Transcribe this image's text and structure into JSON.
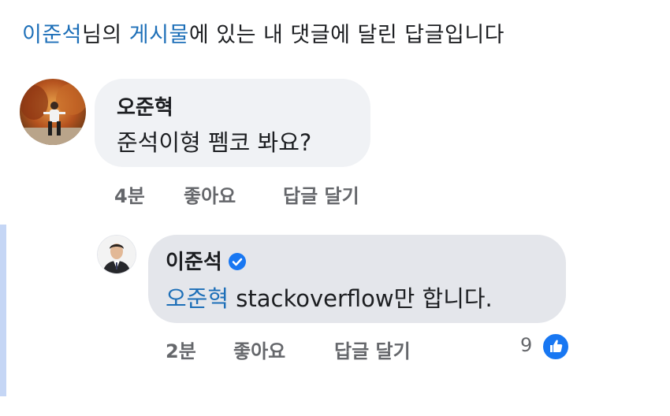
{
  "header": {
    "user_name": "이준석",
    "text_1": "님의 ",
    "post_link": "게시물",
    "text_2": "에 있는 내 댓글에 달린 답글입니다"
  },
  "comment": {
    "author": "오준혁",
    "text": "준석이형 펨코 봐요?",
    "time": "4분",
    "like_label": "좋아요",
    "reply_label": "답글 달기"
  },
  "reply": {
    "author": "이준석",
    "verified": true,
    "mention": "오준혁",
    "text": " stackoverflow만 합니다.",
    "time": "2분",
    "like_label": "좋아요",
    "reply_label": "답글 달기",
    "like_count": "9"
  },
  "colors": {
    "link": "#1d6fb8",
    "verified": "#1877f2",
    "bubble": "#f0f2f5",
    "reply_bubble": "#e4e6eb",
    "thread_line": "#c5d6f5"
  }
}
